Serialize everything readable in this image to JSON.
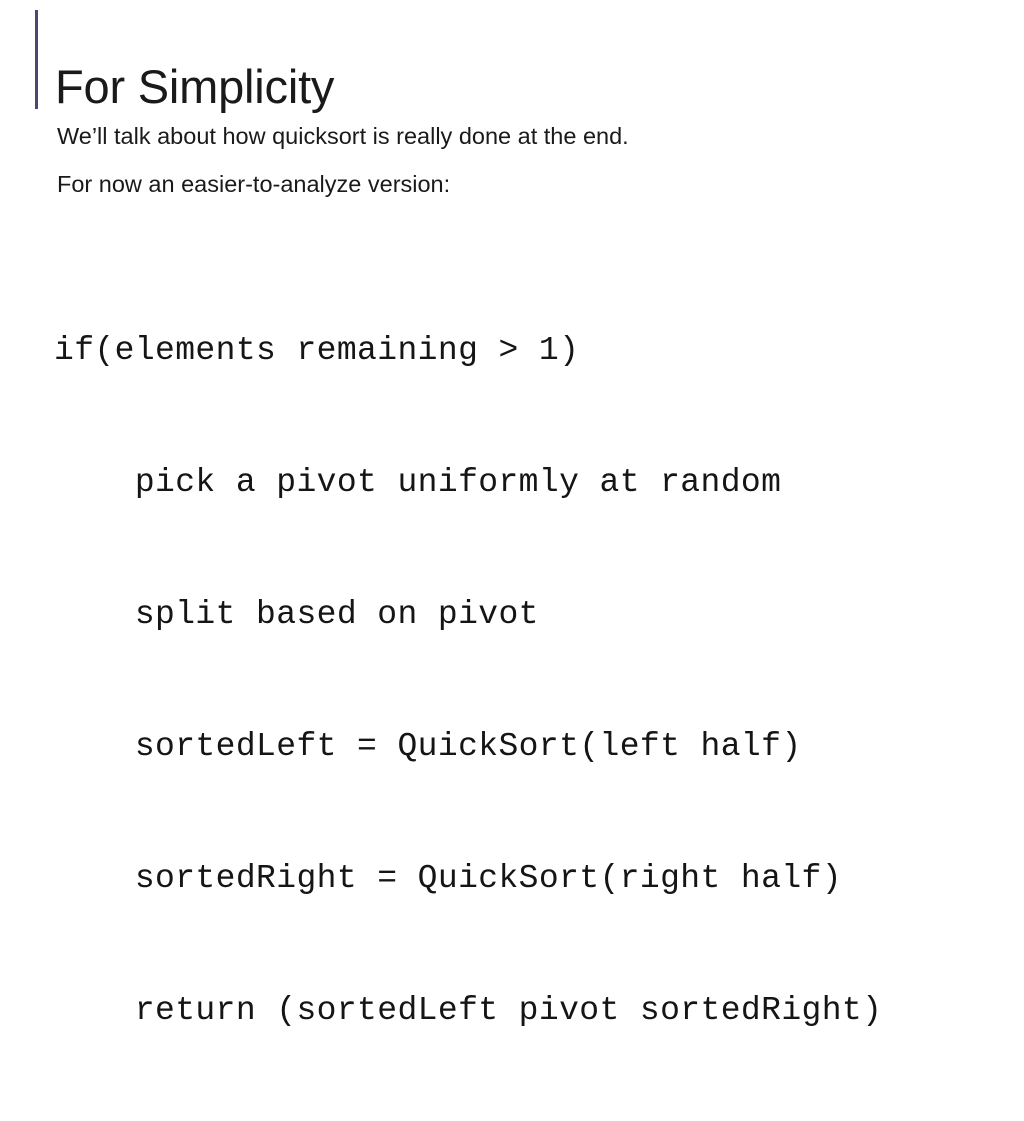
{
  "slide": {
    "title": "For Simplicity",
    "accent_color": "#4C4673",
    "background_color": "#FFFFFF",
    "text_color": "#1A1A1A"
  },
  "body": {
    "lines": [
      "We’ll talk about how quicksort is really done at the end.",
      "For now an easier-to-analyze version:"
    ]
  },
  "code": {
    "lines": [
      "if(elements remaining > 1)",
      "    pick a pivot uniformly at random",
      "    split based on pivot",
      "    sortedLeft = QuickSort(left half)",
      "    sortedRight = QuickSort(right half)",
      "    return (sortedLeft pivot sortedRight)"
    ]
  }
}
